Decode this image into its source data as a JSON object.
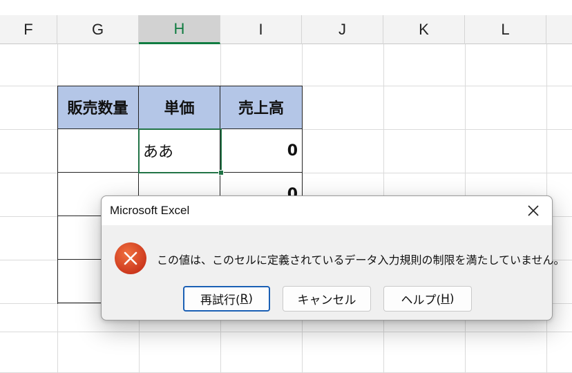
{
  "sheet": {
    "columns": [
      "F",
      "G",
      "H",
      "I",
      "J",
      "K",
      "L"
    ],
    "selected_column": "H",
    "table": {
      "headers": [
        "販売数量",
        "単価",
        "売上高"
      ],
      "rows": [
        [
          "",
          "ああ",
          "0"
        ],
        [
          "",
          "",
          "0"
        ],
        [
          "",
          "",
          ""
        ],
        [
          "",
          "",
          ""
        ]
      ]
    }
  },
  "dialog": {
    "title": "Microsoft Excel",
    "message": "この値は、このセルに定義されているデータ入力規則の制限を満たしていません。",
    "buttons": {
      "retry": {
        "label": "再試行(",
        "accel": "R",
        "suffix": ")"
      },
      "cancel": {
        "label": "キャンセル"
      },
      "help": {
        "label": "ヘルプ(",
        "accel": "H",
        "suffix": ")"
      }
    },
    "icon": "error-icon",
    "colors": {
      "error_icon": "#d9401f",
      "default_button_border": "#1a5fb4"
    }
  },
  "colors": {
    "header_fill": "#b4c6e7",
    "active_cell": "#217346",
    "selected_column_text": "#107c41"
  }
}
